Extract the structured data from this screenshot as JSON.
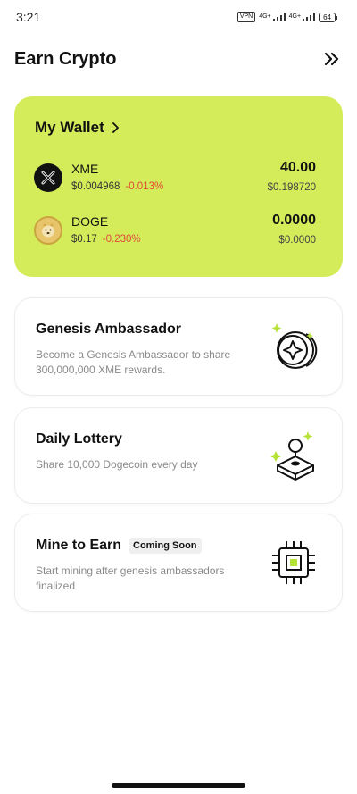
{
  "status_bar": {
    "time": "3:21",
    "vpn": "VPN",
    "network_1": "4G+",
    "network_2": "4G+",
    "battery": "64"
  },
  "header": {
    "title": "Earn Crypto",
    "action_icon": "double-chevron-right-icon"
  },
  "wallet": {
    "title": "My Wallet",
    "background_color": "#d4ec5a",
    "assets": [
      {
        "symbol": "XME",
        "price": "$0.004968",
        "change": "-0.013%",
        "amount": "40.00",
        "value": "$0.198720",
        "icon": "xme-coin-icon"
      },
      {
        "symbol": "DOGE",
        "price": "$0.17",
        "change": "-0.230%",
        "amount": "0.0000",
        "value": "$0.0000",
        "icon": "doge-coin-icon"
      }
    ]
  },
  "features": [
    {
      "title": "Genesis Ambassador",
      "description": "Become a Genesis Ambassador to share 300,000,000 XME rewards.",
      "icon": "coins-sparkle-icon"
    },
    {
      "title": "Daily Lottery",
      "description": "Share 10,000 Dogecoin every day",
      "icon": "joystick-icon"
    },
    {
      "title": "Mine to Earn",
      "badge": "Coming Soon",
      "description": "Start mining after genesis ambassadors finalized",
      "icon": "chip-icon"
    }
  ],
  "colors": {
    "accent": "#d4ec5a",
    "negative": "#e14a3a",
    "muted_text": "#8a8a8a"
  }
}
